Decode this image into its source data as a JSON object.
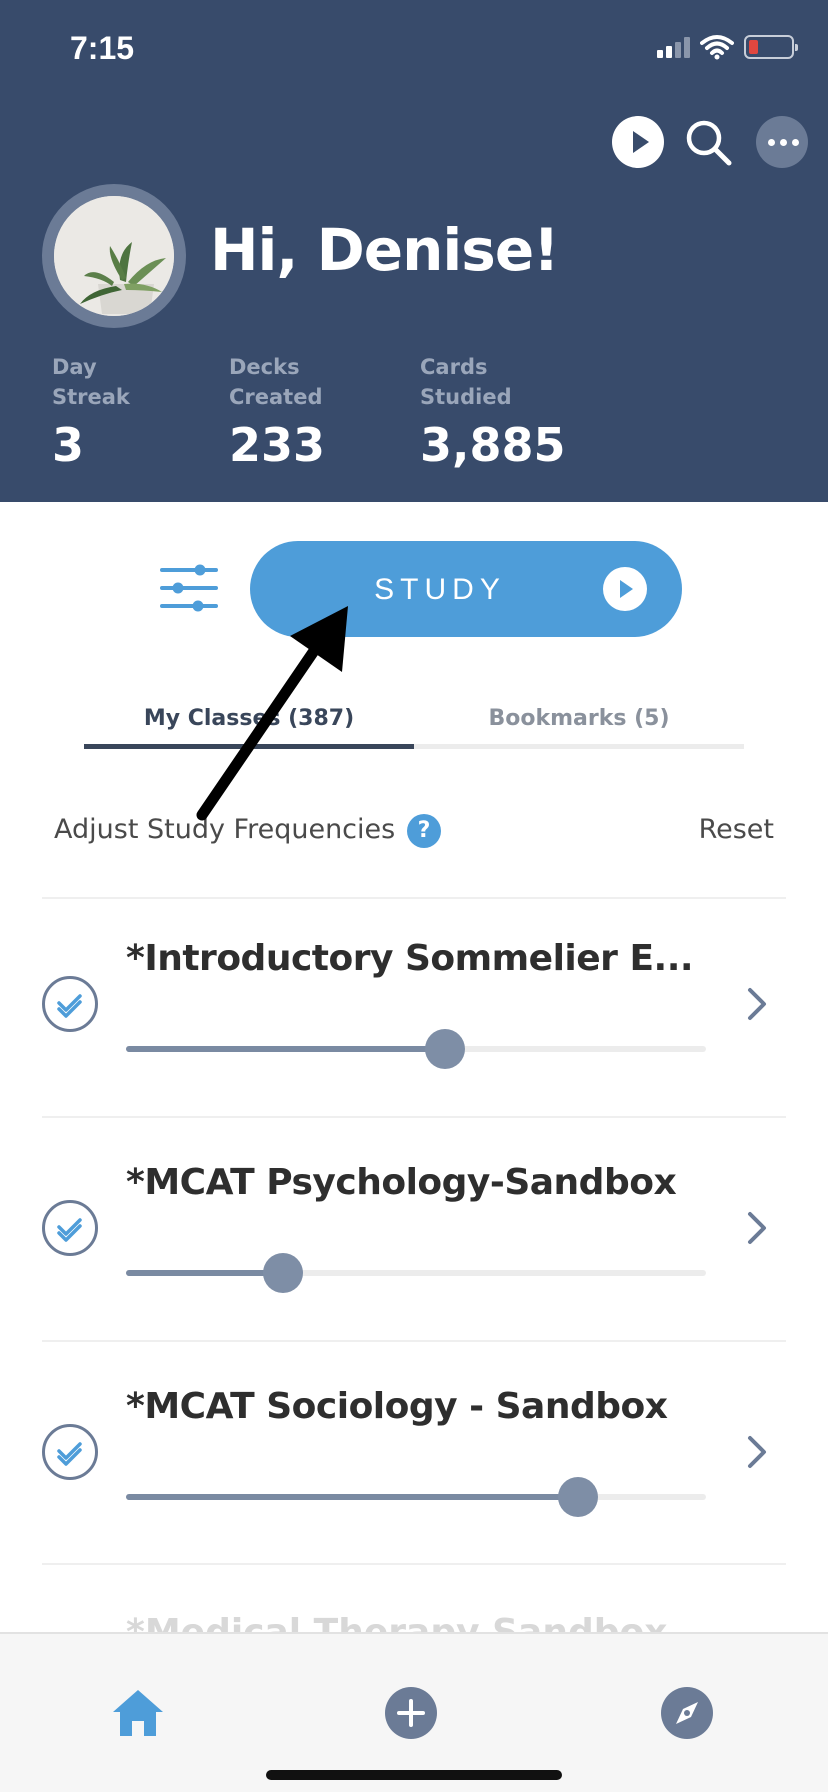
{
  "status_bar": {
    "time": "7:15"
  },
  "header": {
    "greeting": "Hi, Denise!",
    "stats": [
      {
        "label_line1": "Day",
        "label_line2": "Streak",
        "value": "3"
      },
      {
        "label_line1": "Decks",
        "label_line2": "Created",
        "value": "233"
      },
      {
        "label_line1": "Cards",
        "label_line2": "Studied",
        "value": "3,885"
      }
    ]
  },
  "study": {
    "label": "STUDY"
  },
  "tabs": [
    {
      "label": "My Classes (387)",
      "active": true
    },
    {
      "label": "Bookmarks (5)",
      "active": false
    }
  ],
  "frequency": {
    "label": "Adjust Study Frequencies",
    "help": "?",
    "reset": "Reset"
  },
  "decks": [
    {
      "title": "*Introductory Sommelier E...",
      "frequency": 0.55,
      "checked": true
    },
    {
      "title": "*MCAT Psychology-Sandbox",
      "frequency": 0.27,
      "checked": true
    },
    {
      "title": "*MCAT Sociology - Sandbox",
      "frequency": 0.78,
      "checked": true
    }
  ],
  "partial_deck_title": "*Medical Therapy Sandbox",
  "bottom_nav": [
    {
      "icon": "home-icon",
      "active": true
    },
    {
      "icon": "add-icon"
    },
    {
      "icon": "compass-icon"
    }
  ],
  "colors": {
    "header_bg": "#384b6b",
    "accent": "#4e9dd9",
    "slider": "#7e8ea6"
  }
}
